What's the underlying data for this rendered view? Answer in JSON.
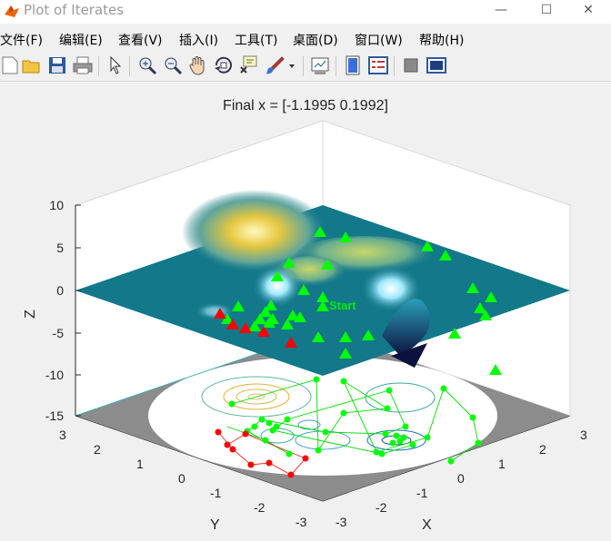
{
  "window": {
    "title": "Plot of Iterates",
    "minimize": "—",
    "maximize": "☐",
    "close": "✕"
  },
  "menu": [
    "文件(F)",
    "编辑(E)",
    "查看(V)",
    "插入(I)",
    "工具(T)",
    "桌面(D)",
    "窗口(W)",
    "帮助(H)"
  ],
  "toolbar": [
    "new-figure-icon",
    "open-icon",
    "save-icon",
    "print-icon",
    "pointer-icon",
    "zoom-in-icon",
    "zoom-out-icon",
    "pan-icon",
    "rotate-3d-icon",
    "data-cursor-icon",
    "brush-icon",
    "dropdown-arrow-icon",
    "link-plot-icon",
    "colorbar-icon",
    "legend-icon",
    "hide-plot-tools-icon",
    "show-plot-tools-icon"
  ],
  "chart_data": {
    "type": "scatter",
    "title": "Final x = [-1.1995 0.1992]",
    "xlabel": "X",
    "ylabel": "Y",
    "zlabel": "Z",
    "xlim": [
      -3,
      3
    ],
    "ylim": [
      -3,
      3
    ],
    "zlim": [
      -15,
      10
    ],
    "x_ticks": [
      "-3",
      "-2",
      "-1",
      "0",
      "1",
      "2",
      "3"
    ],
    "y_ticks": [
      "-3",
      "-2",
      "-1",
      "0",
      "1",
      "2",
      "3"
    ],
    "z_ticks": [
      "10",
      "5",
      "0",
      "-5",
      "-10",
      "-15"
    ],
    "annotation": "Start",
    "colors": {
      "iterates": "#00ff00",
      "initial_points": "#ff0000",
      "surface_low": "#12788a",
      "surface_high": "#ffe040"
    }
  }
}
